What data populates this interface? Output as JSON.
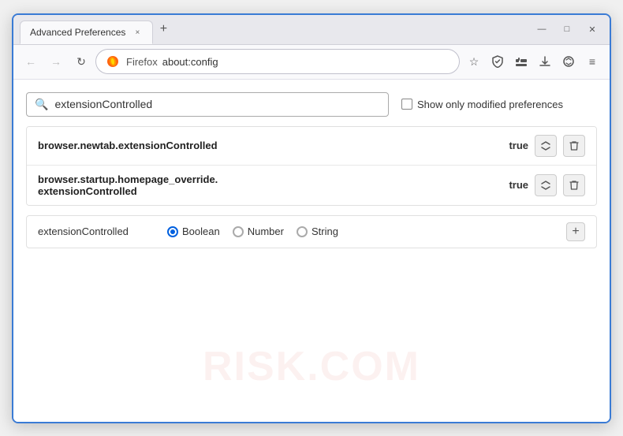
{
  "window": {
    "title": "Advanced Preferences",
    "tab_close": "×",
    "tab_new": "+",
    "min": "—",
    "max": "□",
    "close": "✕"
  },
  "navbar": {
    "back": "←",
    "forward": "→",
    "refresh": "↻",
    "site_name": "Firefox",
    "url": "about:config",
    "bookmark": "☆",
    "shield": "⛨",
    "extension": "🧩",
    "download": "⬇",
    "account": "○",
    "menu": "≡"
  },
  "search": {
    "placeholder": "extensionControlled",
    "value": "extensionControlled",
    "search_icon": "🔍",
    "checkbox_label": "Show only modified preferences"
  },
  "results": [
    {
      "name": "browser.newtab.extensionControlled",
      "value": "true"
    },
    {
      "name": "browser.startup.homepage_override.\nextensionControlled",
      "name_line1": "browser.startup.homepage_override.",
      "name_line2": "extensionControlled",
      "value": "true",
      "multiline": true
    }
  ],
  "add_row": {
    "pref_name": "extensionControlled",
    "types": [
      {
        "label": "Boolean",
        "selected": true
      },
      {
        "label": "Number",
        "selected": false
      },
      {
        "label": "String",
        "selected": false
      }
    ],
    "add_btn": "+"
  },
  "watermark": "RISK.COM"
}
